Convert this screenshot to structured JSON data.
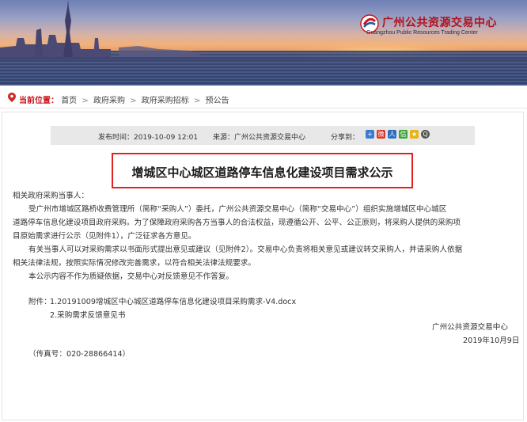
{
  "header": {
    "logo_cn": "广州公共资源交易中心",
    "logo_en": "Guangzhou Public Resources Trading Center"
  },
  "breadcrumb": {
    "label": "当前位置",
    "colon": "：",
    "items": [
      "首页",
      "政府采购",
      "政府采购招标",
      "预公告"
    ],
    "separator": ">"
  },
  "meta": {
    "publish_time": "发布时间：2019-10-09 12:01",
    "source": "来源：广州公共资源交易中心",
    "share_label": "分享到：",
    "share_icons": [
      "plus-icon",
      "sina-weibo-icon",
      "renren-icon",
      "wechat-icon",
      "qq-zone-icon",
      "tencent-weibo-icon"
    ]
  },
  "article": {
    "title": "增城区中心城区道路停车信息化建设项目需求公示",
    "greeting": "相关政府采购当事人：",
    "para1_line1": "受广州市增城区路桥收费管理所（简称“采购人”）委托，广州公共资源交易中心（简称“交易中心”）组织实施增城区中心城区",
    "para1_line2": "道路停车信息化建设项目政府采购。为了保障政府采购各方当事人的合法权益，现遵循公开、公平、公正原则，将采购人提供的采购项",
    "para1_line3": "目原始需求进行公示（见附件1），广泛征求各方意见。",
    "para2_line1": "有关当事人可以对采购需求以书面形式提出意见或建议（见附件2）。交易中心负责将相关意见或建议转交采购人，并请采购人依据",
    "para2_line2": "相关法律法规，按照实际情况修改完善需求，以符合相关法律法规要求。",
    "para3": "本公示内容不作为质疑依据，交易中心对反馈意见不作答复。",
    "attachments_label": "附件：",
    "attachment1": "1.20191009增城区中心城区道路停车信息化建设项目采购需求-V4.docx",
    "attachment2": "2.采购需求反馈意见书",
    "signature_org": "广州公共资源交易中心",
    "signature_date": "2019年10月9日",
    "fax": "（传真号：020-28866414）"
  },
  "colors": {
    "accent_red": "#c8161d",
    "title_border": "#e02222",
    "meta_bg": "#e8e8e8"
  }
}
